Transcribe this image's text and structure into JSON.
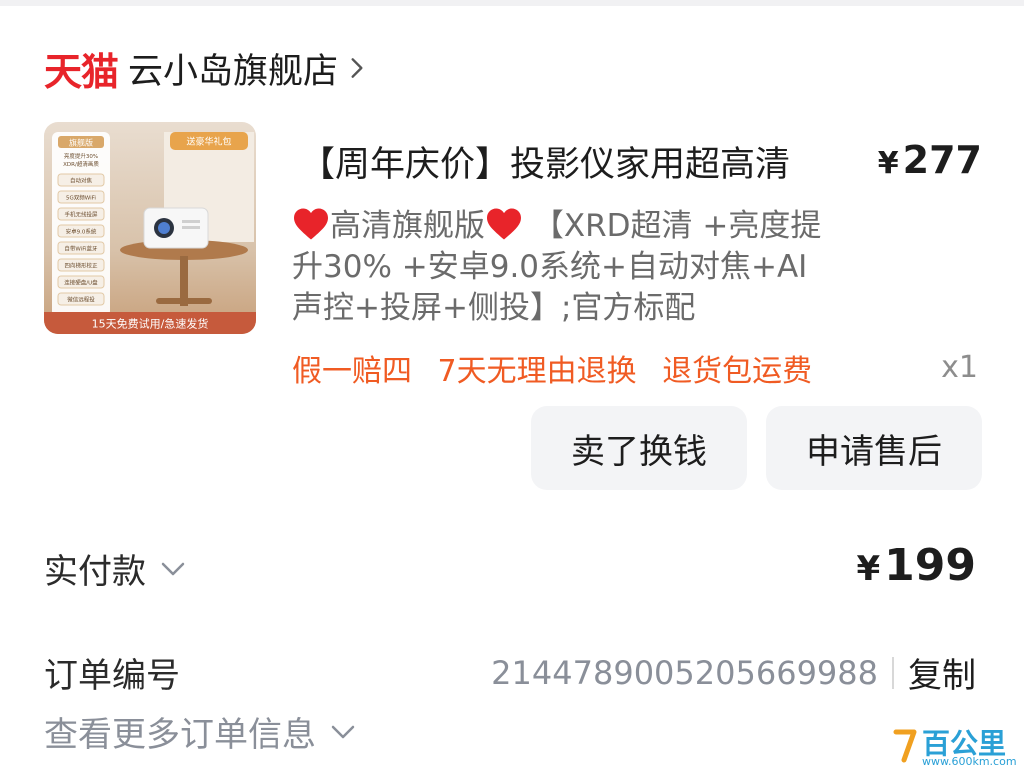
{
  "shop": {
    "platform": "天猫",
    "name": "云小岛旗舰店"
  },
  "product": {
    "title": "【周年庆价】投影仪家用超高清",
    "price_symbol": "¥",
    "price": "277",
    "spec_variant": "高清旗舰版",
    "spec_detail": " 【XRD超清 +亮度提升30% +安卓9.0系统+自动对焦+AI声控+投屏+侧投】;官方标配",
    "guarantees": [
      "假一赔四",
      "7天无理由退换",
      "退货包运费"
    ],
    "quantity": "x1",
    "thumbnail": {
      "badge": "旗舰版",
      "corner_tag": "送豪华礼包",
      "headline": "亮度提升30%",
      "subheadline": "XDR/超清画质",
      "features": [
        "自动对焦",
        "5G双频WiFi",
        "手机无线投屏",
        "安卓9.0系统",
        "自带WiFi蓝牙",
        "四向梯形校正",
        "连接硬盘/U盘",
        "微信远程投"
      ],
      "footer": "15天免费试用/急速发货"
    }
  },
  "actions": {
    "sell": "卖了换钱",
    "after_sale": "申请售后"
  },
  "payment": {
    "label": "实付款",
    "symbol": "¥",
    "amount": "199"
  },
  "order": {
    "label": "订单编号",
    "number": "2144789005205669988",
    "copy": "复制",
    "more": "查看更多订单信息"
  },
  "watermark": {
    "main": "百公里",
    "url": "www.600km.com"
  },
  "colors": {
    "tmall_red": "#e8242a",
    "guarantee_orange": "#f05b23",
    "muted_gray": "#8a8f99",
    "button_bg": "#f3f4f6"
  }
}
